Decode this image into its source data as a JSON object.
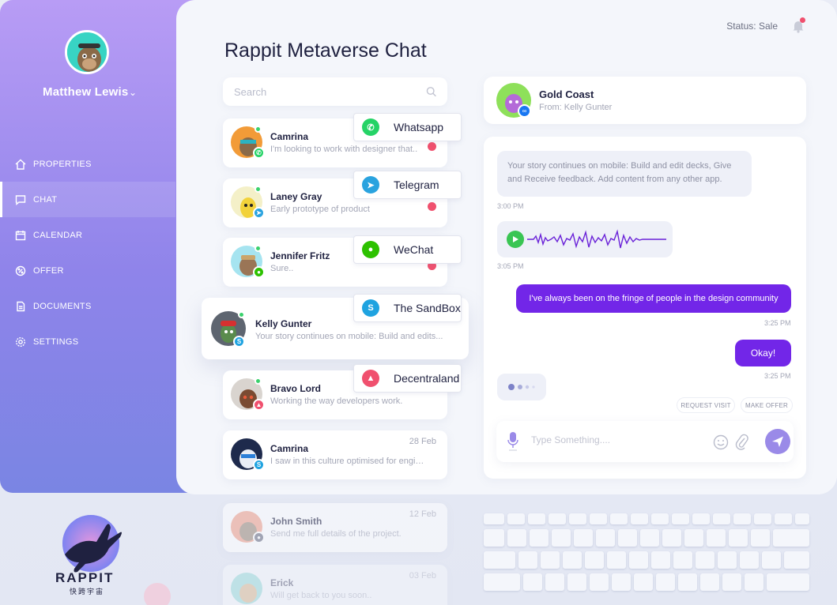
{
  "sidebar": {
    "user_name": "Matthew Lewis",
    "nav": [
      {
        "label": "PROPERTIES",
        "icon": "home-icon"
      },
      {
        "label": "CHAT",
        "icon": "chat-icon"
      },
      {
        "label": "CALENDAR",
        "icon": "calendar-icon"
      },
      {
        "label": "OFFER",
        "icon": "offer-icon"
      },
      {
        "label": "DOCUMENTS",
        "icon": "documents-icon"
      },
      {
        "label": "SETTINGS",
        "icon": "gear-icon"
      }
    ],
    "active": "CHAT"
  },
  "header": {
    "title": "Rappit Metaverse Chat",
    "status": "Status: Sale"
  },
  "search": {
    "placeholder": "Search"
  },
  "chats": [
    {
      "name": "Camrina",
      "message": "I'm looking to work with designer that..",
      "date": "",
      "source": "whatsapp"
    },
    {
      "name": "Laney Gray",
      "message": "Early prototype of product",
      "date": "",
      "source": "telegram"
    },
    {
      "name": "Jennifer Fritz",
      "message": "Sure..",
      "date": "",
      "source": "wechat"
    },
    {
      "name": "Kelly Gunter",
      "message": "Your story continues on mobile: Build and edits...",
      "date": "",
      "source": "sandbox"
    },
    {
      "name": "Bravo Lord",
      "message": "Working the way developers work.",
      "date": "",
      "source": "decentraland"
    },
    {
      "name": "Camrina",
      "message": "I saw in this culture optimised for engine...",
      "date": "28 Feb",
      "source": "sandbox"
    },
    {
      "name": "John Smith",
      "message": "Send me full details of the project.",
      "date": "12 Feb",
      "source": "other"
    },
    {
      "name": "Erick",
      "message": "Will get back to you soon..",
      "date": "03 Feb",
      "source": "other"
    }
  ],
  "platforms": [
    "Whatsapp",
    "Telegram",
    "WeChat",
    "The SandBox",
    "Decentraland"
  ],
  "conversation": {
    "name": "Gold Coast",
    "from": "From: Kelly Gunter",
    "messages": [
      {
        "text": "Your story continues on mobile: Build and edit decks, Give and Receive feedback. Add content from any other app.",
        "time": "3:00 PM"
      },
      {
        "text": "",
        "time": "3:05 PM"
      },
      {
        "text": "I've always been on the fringe of people in the design community",
        "time": "3:25 PM"
      },
      {
        "text": "Okay!",
        "time": "3:25 PM"
      }
    ],
    "actions": [
      "REQUEST VISIT",
      "MAKE OFFER"
    ],
    "composer_placeholder": "Type Something...."
  },
  "brand": {
    "name": "RAPPIT",
    "sub": "快跨宇宙"
  },
  "colors": {
    "accent": "#7226e8",
    "sidebar_top": "#b89cf5",
    "sidebar_bottom": "#7a85e3",
    "online": "#3ad16c"
  }
}
